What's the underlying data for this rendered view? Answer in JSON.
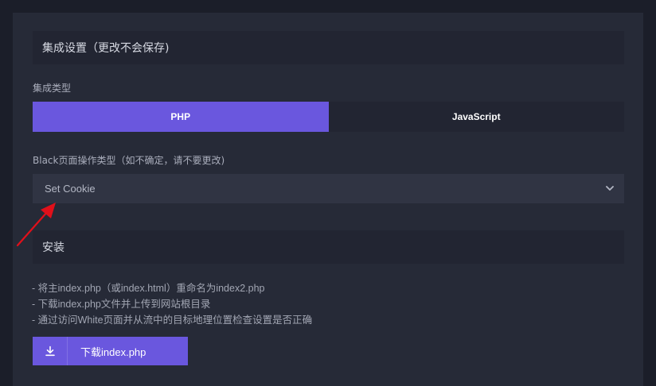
{
  "integration": {
    "header": "集成设置（更改不会保存)",
    "type_label": "集成类型",
    "options": [
      "PHP",
      "JavaScript"
    ],
    "selected_option": "PHP"
  },
  "black_action": {
    "label": "Black页面操作类型（如不确定，请不要更改)",
    "selected_value": "Set Cookie"
  },
  "install": {
    "header": "安装",
    "steps": [
      "- 将主index.php（或index.html）重命名为index2.php",
      "- 下载index.php文件并上传到网站根目录",
      "- 通过访问White页面并从流中的目标地理位置检查设置是否正确"
    ],
    "download_button": "下载index.php"
  },
  "colors": {
    "accent": "#6a57de",
    "annotation_arrow": "#e0101a"
  },
  "icons": [
    "chevron-down-icon",
    "download-icon",
    "annotation-arrow"
  ]
}
